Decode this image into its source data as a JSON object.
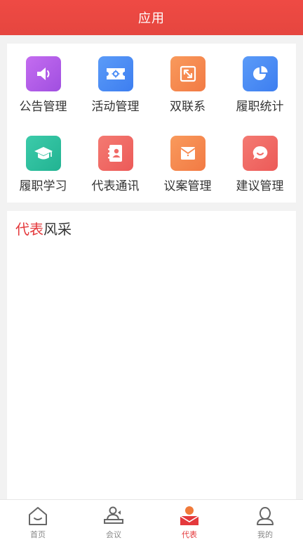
{
  "header": {
    "title": "应用"
  },
  "apps": [
    {
      "label": "公告管理",
      "icon": "speaker-icon",
      "color": "#b45ee6"
    },
    {
      "label": "活动管理",
      "icon": "ticket-icon",
      "color": "#4d8ef6"
    },
    {
      "label": "双联系",
      "icon": "expand-icon",
      "color": "#f7894f"
    },
    {
      "label": "履职统计",
      "icon": "pie-chart-icon",
      "color": "#4d8ef6"
    },
    {
      "label": "履职学习",
      "icon": "graduation-cap-icon",
      "color": "#2fc0a0"
    },
    {
      "label": "代表通讯",
      "icon": "address-book-icon",
      "color": "#f06a66"
    },
    {
      "label": "议案管理",
      "icon": "envelope-icon",
      "color": "#f7894f"
    },
    {
      "label": "建议管理",
      "icon": "chat-bubble-icon",
      "color": "#f06a66"
    }
  ],
  "feature": {
    "title_accent": "代表",
    "title_rest": "风采"
  },
  "tabbar": {
    "items": [
      {
        "label": "首页",
        "icon": "home-icon",
        "active": false
      },
      {
        "label": "会议",
        "icon": "meeting-icon",
        "active": false
      },
      {
        "label": "代表",
        "icon": "representative-icon",
        "active": true
      },
      {
        "label": "我的",
        "icon": "profile-icon",
        "active": false
      }
    ]
  },
  "colors": {
    "brand": "#e4393c",
    "inactive": "#888888"
  }
}
